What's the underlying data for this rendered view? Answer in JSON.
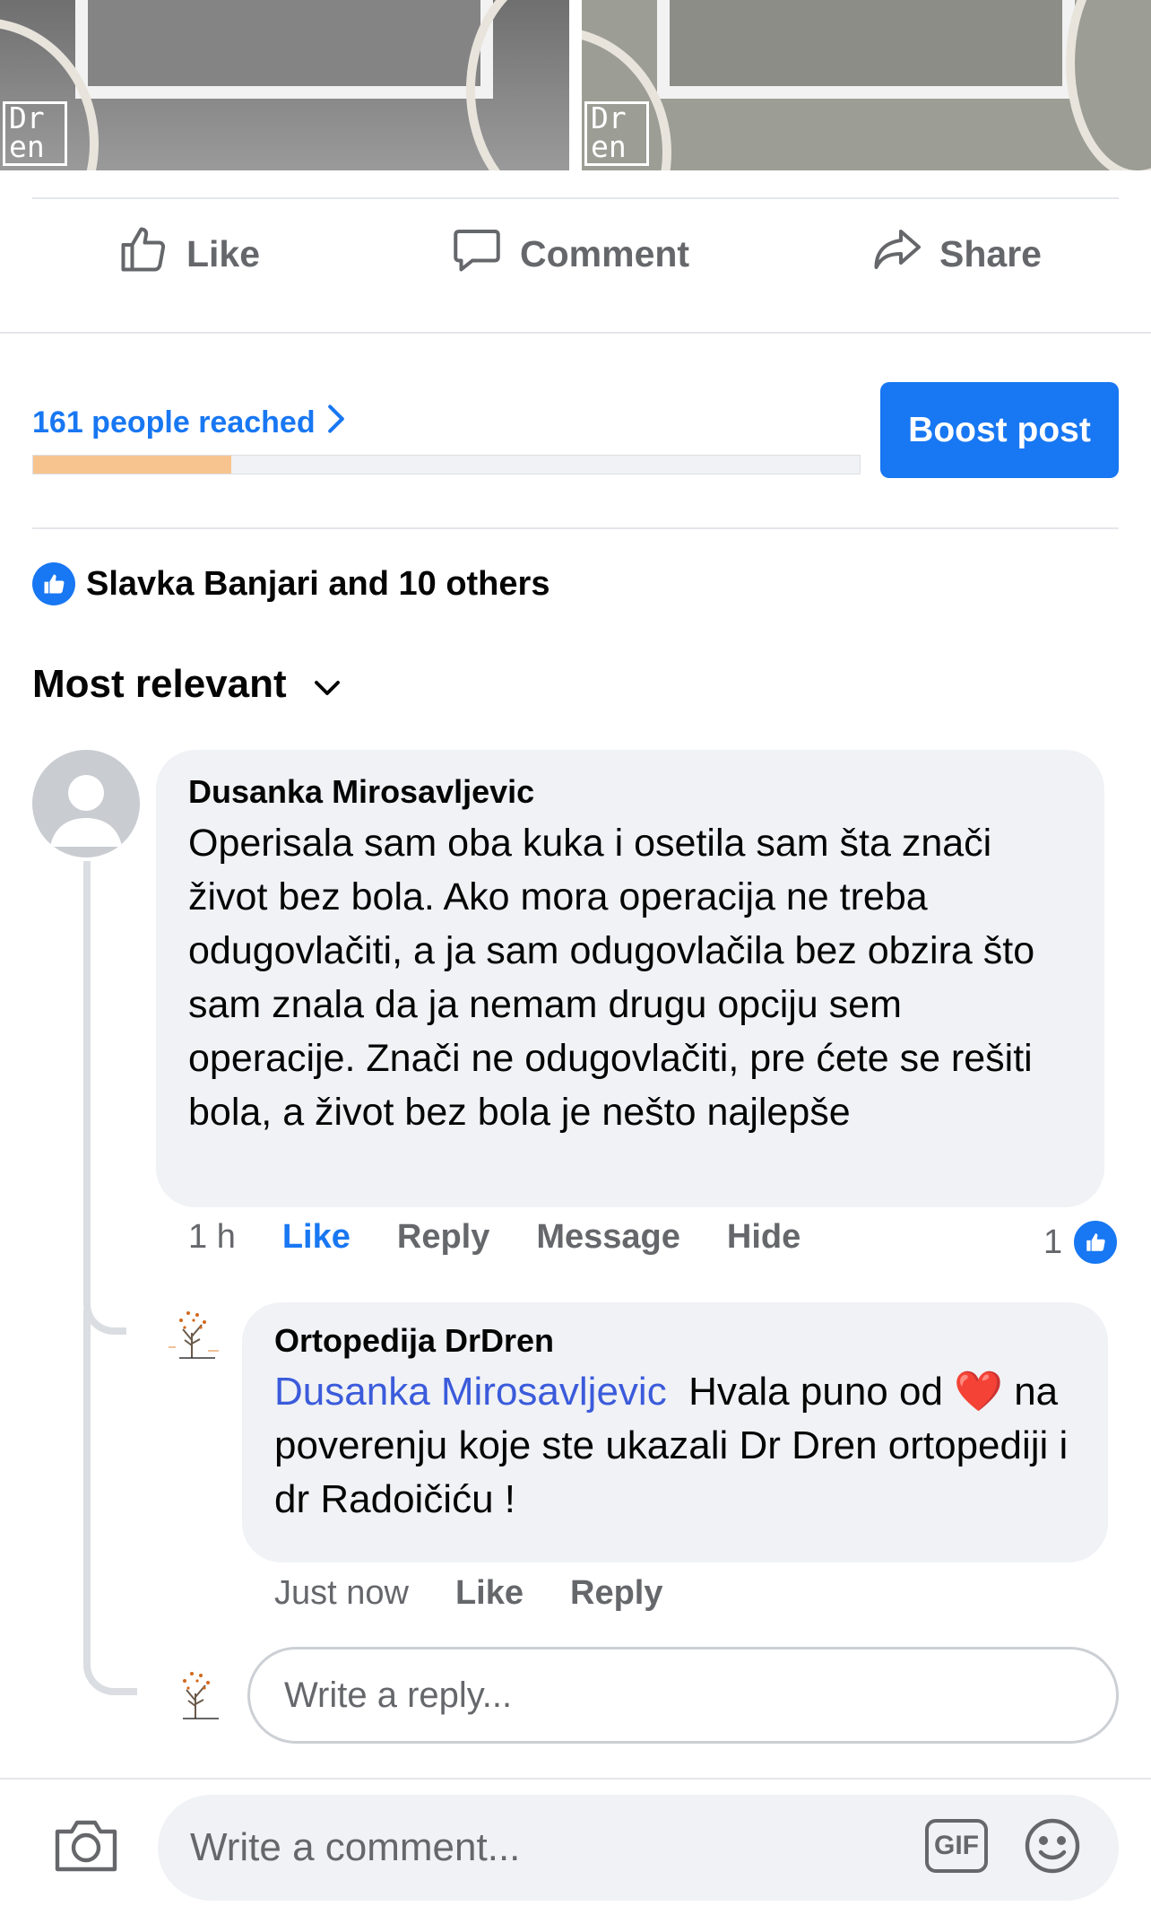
{
  "photos": {
    "logo_line1": "Dr",
    "logo_line2": "en"
  },
  "actions": {
    "like": "Like",
    "comment": "Comment",
    "share": "Share"
  },
  "insights": {
    "reach_label": "161 people reached",
    "reach_progress": 0.24,
    "boost_label": "Boost post"
  },
  "reactions": {
    "summary": "Slavka Banjari and 10 others"
  },
  "sort": {
    "label": "Most relevant"
  },
  "comment": {
    "author": "Dusanka Mirosavljevic",
    "text": "Operisala sam oba kuka i osetila sam  šta znači život bez bola. Ako mora operacija ne treba odugovlačiti, a ja sam odugovlačila  bez obzira što sam znala da ja nemam drugu opciju sem operacije. Znači  ne odugovlačiti, pre ćete se rešiti bola, a život bez bola je nešto najlepše",
    "time": "1 h",
    "like": "Like",
    "reply": "Reply",
    "message": "Message",
    "hide": "Hide",
    "reaction_count": "1"
  },
  "reply": {
    "author": "Ortopedija DrDren",
    "mention": "Dusanka Mirosavljevic",
    "text_part1": "Hvala puno od",
    "heart": "❤️",
    "text_part2": "na poverenju koje ste ukazali Dr Dren ortopediji i dr Radoičiću !",
    "time": "Just now",
    "like": "Like",
    "reply": "Reply"
  },
  "reply_input": {
    "placeholder": "Write a reply..."
  },
  "composer": {
    "placeholder": "Write a comment...",
    "gif_label": "GIF"
  },
  "icons": {
    "like": "thumbs-up-icon",
    "comment": "speech-bubble-icon",
    "share": "share-arrow-icon",
    "chevron": "chevron-right-icon",
    "sort": "chevron-down-icon",
    "camera": "camera-icon",
    "emoji": "smiley-icon"
  },
  "colors": {
    "accent": "#1877f2",
    "reach_bar": "#f7c48f",
    "mention": "#3b5bdb"
  }
}
